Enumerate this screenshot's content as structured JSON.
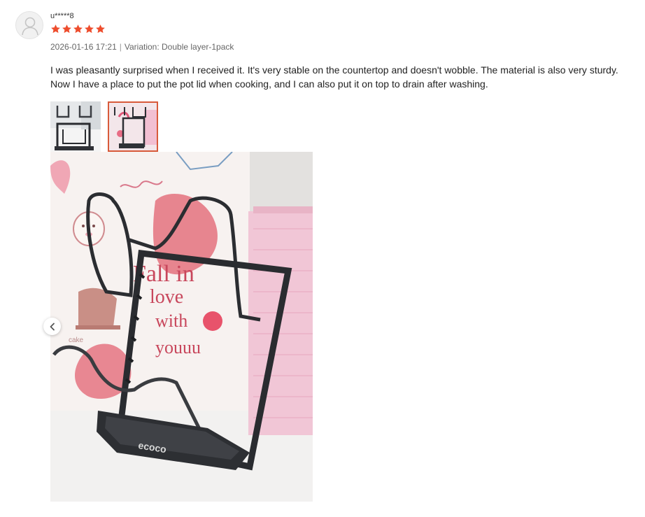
{
  "review": {
    "username": "u*****8",
    "rating": 5,
    "date": "2026-01-16 17:21",
    "separator": "|",
    "variation": "Variation: Double layer-1pack",
    "text": "I was pleasantly surprised when I received it. It's very stable on the countertop and doesn't wobble. The material is also very sturdy. Now I have a place to put the pot lid when cooking, and I can also put it on top to drain after washing.",
    "image_count": 2,
    "selected_image_index": 1
  },
  "colors": {
    "star": "#ee4d2d",
    "selected_border": "#d85a3a",
    "meta_text": "#666666"
  },
  "icons": {
    "avatar": "user-silhouette-icon",
    "rating": "star-icon",
    "prev": "chevron-left-icon"
  },
  "main_image": {
    "sign_line1": "Fall in",
    "sign_line2": "love",
    "sign_line3": "with",
    "sign_line4": "youuu",
    "brand": "ecoco",
    "cake_label": "cake"
  }
}
